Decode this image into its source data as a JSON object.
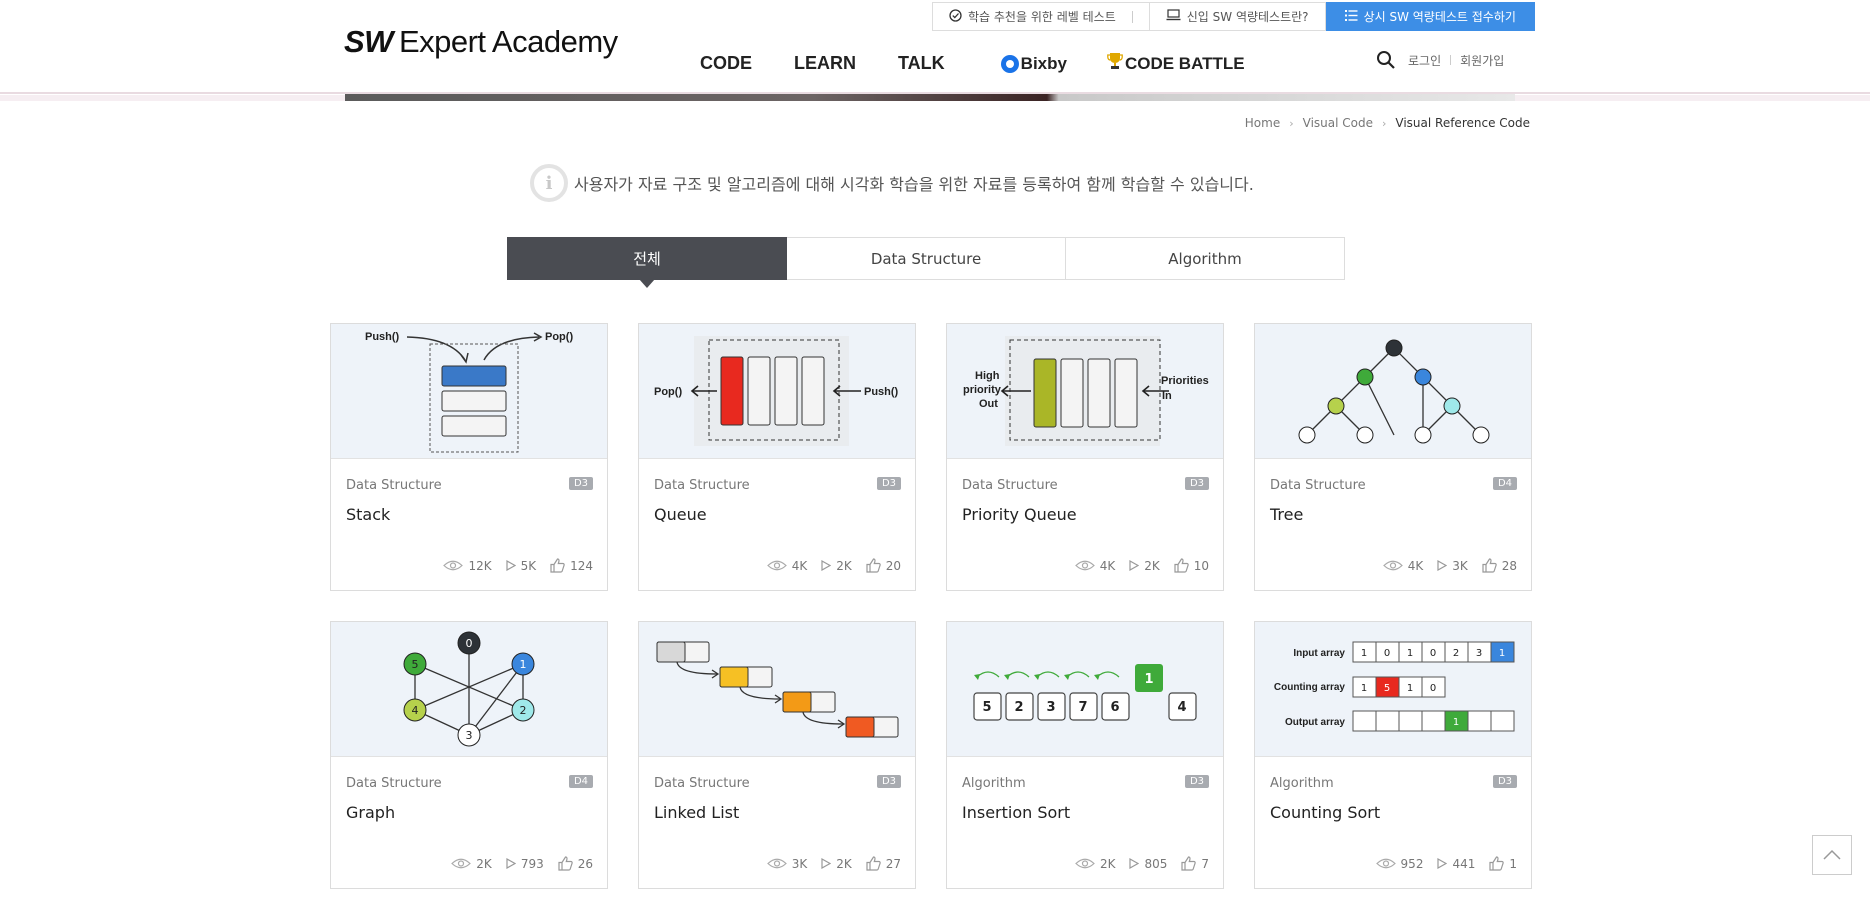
{
  "header": {
    "logo_bold": "SW",
    "logo_rest": "Expert Academy",
    "nav": [
      "CODE",
      "LEARN",
      "TALK"
    ],
    "bixby": "Bixby",
    "code_battle": "CODE BATTLE",
    "top_links": {
      "level_test": "학습 추천을 위한 레벨 테스트",
      "new_test": "신입 SW 역량테스트란?",
      "apply": "상시 SW 역량테스트 접수하기"
    },
    "login": "로그인",
    "signup": "회원가입"
  },
  "breadcrumb": [
    "Home",
    "Visual Code",
    "Visual Reference Code"
  ],
  "notice": "사용자가 자료 구조 및 알고리즘에 대해 시각화 학습을 위한 자료를 등록하여 함께 학습할 수 있습니다.",
  "tabs": [
    "전체",
    "Data Structure",
    "Algorithm"
  ],
  "cards": [
    {
      "category": "Data Structure",
      "level": "D3",
      "title": "Stack",
      "views": "12K",
      "plays": "5K",
      "likes": "124"
    },
    {
      "category": "Data Structure",
      "level": "D3",
      "title": "Queue",
      "views": "4K",
      "plays": "2K",
      "likes": "20"
    },
    {
      "category": "Data Structure",
      "level": "D3",
      "title": "Priority Queue",
      "views": "4K",
      "plays": "2K",
      "likes": "10"
    },
    {
      "category": "Data Structure",
      "level": "D4",
      "title": "Tree",
      "views": "4K",
      "plays": "3K",
      "likes": "28"
    },
    {
      "category": "Data Structure",
      "level": "D4",
      "title": "Graph",
      "views": "2K",
      "plays": "793",
      "likes": "26"
    },
    {
      "category": "Data Structure",
      "level": "D3",
      "title": "Linked List",
      "views": "3K",
      "plays": "2K",
      "likes": "27"
    },
    {
      "category": "Algorithm",
      "level": "D3",
      "title": "Insertion Sort",
      "views": "2K",
      "plays": "805",
      "likes": "7"
    },
    {
      "category": "Algorithm",
      "level": "D3",
      "title": "Counting Sort",
      "views": "952",
      "plays": "441",
      "likes": "1"
    }
  ],
  "thumbs": {
    "stack": {
      "push": "Push()",
      "pop": "Pop()"
    },
    "queue": {
      "pop": "Pop()",
      "push": "Push()"
    },
    "pq": {
      "out1": "High",
      "out2": "priority",
      "out3": "Out",
      "in1": "Priorities",
      "in2": "In"
    },
    "graph": {
      "n0": "0",
      "n1": "1",
      "n2": "2",
      "n3": "3",
      "n4": "4",
      "n5": "5"
    },
    "insertion": {
      "vals": [
        "5",
        "2",
        "3",
        "7",
        "6"
      ],
      "key": "1",
      "side": "4"
    },
    "counting": {
      "input_label": "Input array",
      "count_label": "Counting array",
      "output_label": "Output array",
      "input": [
        "1",
        "0",
        "1",
        "0",
        "2",
        "3",
        "1"
      ],
      "count": [
        "1",
        "5",
        "1",
        "0"
      ],
      "output": [
        "",
        "",
        "",
        "",
        "1",
        "",
        ""
      ]
    }
  },
  "colors": {
    "accent": "#3d8ee6",
    "tab_active": "#4a4c52"
  }
}
